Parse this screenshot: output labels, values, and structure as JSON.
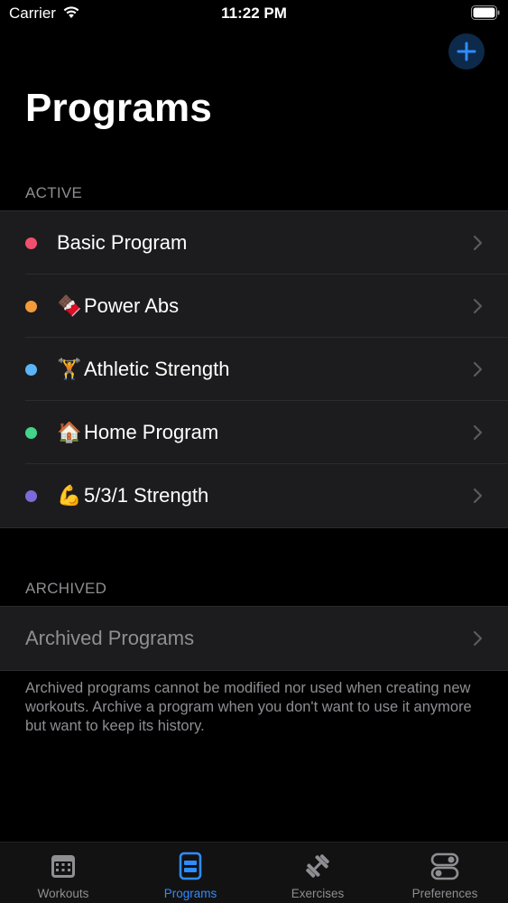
{
  "status_bar": {
    "carrier": "Carrier",
    "time": "11:22 PM"
  },
  "page": {
    "title": "Programs"
  },
  "active_section": {
    "header": "ACTIVE",
    "items": [
      {
        "emoji": "",
        "label": "Basic Program",
        "color": "#f0506e"
      },
      {
        "emoji": "🍫",
        "label": "Power Abs",
        "color": "#f59a3a"
      },
      {
        "emoji": "🏋️",
        "label": "Athletic Strength",
        "color": "#5bb4f5"
      },
      {
        "emoji": "🏠",
        "label": "Home Program",
        "color": "#44d38a"
      },
      {
        "emoji": "💪",
        "label": "5/3/1 Strength",
        "color": "#7b6bd8"
      }
    ]
  },
  "archived_section": {
    "header": "ARCHIVED",
    "item_label": "Archived Programs",
    "footnote": "Archived programs cannot be modified nor used when creating new workouts. Archive a program when you don't want to use it anymore but want to keep its history."
  },
  "tabs": [
    {
      "label": "Workouts",
      "icon": "calendar-icon",
      "active": false
    },
    {
      "label": "Programs",
      "icon": "program-icon",
      "active": true
    },
    {
      "label": "Exercises",
      "icon": "dumbbell-icon",
      "active": false
    },
    {
      "label": "Preferences",
      "icon": "toggles-icon",
      "active": false
    }
  ],
  "colors": {
    "accent": "#2f8cff",
    "background": "#000000",
    "cell": "#1c1c1e",
    "secondary_text": "#8e8e93"
  }
}
